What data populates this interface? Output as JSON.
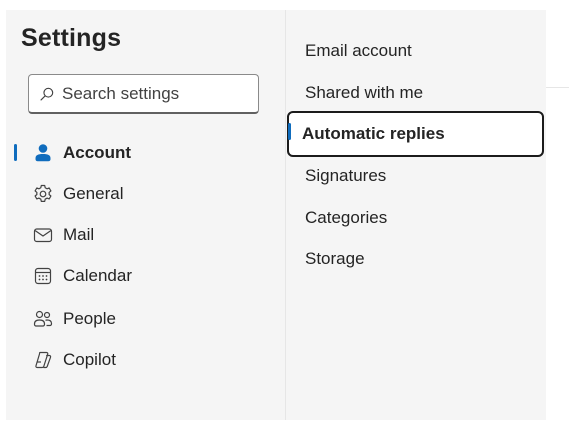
{
  "settings": {
    "title": "Settings",
    "search_placeholder": "Search settings"
  },
  "nav": {
    "items": [
      {
        "label": "Account",
        "icon": "person-icon",
        "selected": true
      },
      {
        "label": "General",
        "icon": "gear-icon",
        "selected": false
      },
      {
        "label": "Mail",
        "icon": "mail-icon",
        "selected": false
      },
      {
        "label": "Calendar",
        "icon": "calendar-icon",
        "selected": false
      },
      {
        "label": "People",
        "icon": "people-icon",
        "selected": false
      },
      {
        "label": "Copilot",
        "icon": "copilot-icon",
        "selected": false
      }
    ]
  },
  "subnav": {
    "items": [
      {
        "label": "Email account",
        "selected": false
      },
      {
        "label": "Shared with me",
        "selected": false
      },
      {
        "label": "Automatic replies",
        "selected": true
      },
      {
        "label": "Signatures",
        "selected": false
      },
      {
        "label": "Categories",
        "selected": false
      },
      {
        "label": "Storage",
        "selected": false
      }
    ]
  },
  "colors": {
    "accent": "#0f6cbd",
    "pane_background": "#f5f5f5",
    "text": "#242424"
  }
}
